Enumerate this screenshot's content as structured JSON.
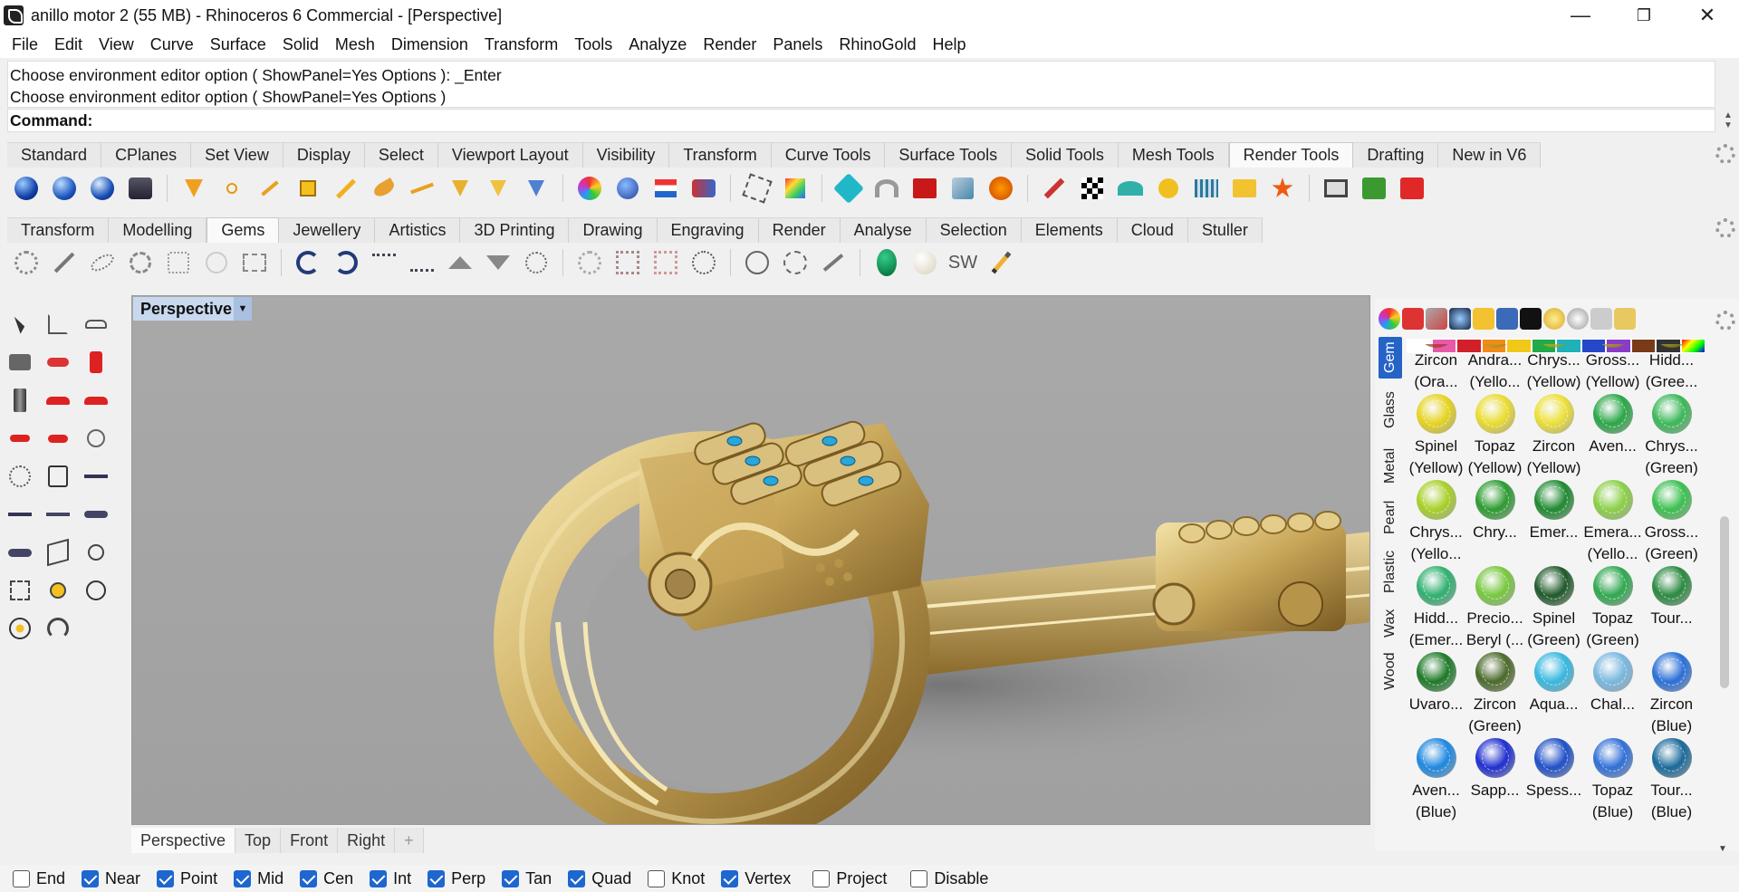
{
  "window": {
    "title": "anillo motor 2 (55 MB) - Rhinoceros 6 Commercial - [Perspective]",
    "controls": {
      "minimize": "—",
      "restore": "❐",
      "close": "✕"
    }
  },
  "menu": [
    "File",
    "Edit",
    "View",
    "Curve",
    "Surface",
    "Solid",
    "Mesh",
    "Dimension",
    "Transform",
    "Tools",
    "Analyze",
    "Render",
    "Panels",
    "RhinoGold",
    "Help"
  ],
  "command": {
    "history": [
      "Choose environment editor option ( ShowPanel=Yes  Options ): _Enter",
      "Choose environment editor option ( ShowPanel=Yes  Options )"
    ],
    "prompt": "Command:"
  },
  "toolbar_tabs_1": {
    "items": [
      "Standard",
      "CPlanes",
      "Set View",
      "Display",
      "Select",
      "Viewport Layout",
      "Visibility",
      "Transform",
      "Curve Tools",
      "Surface Tools",
      "Solid Tools",
      "Mesh Tools",
      "Render Tools",
      "Drafting",
      "New in V6"
    ],
    "active": "Render Tools"
  },
  "toolbar_tabs_2": {
    "items": [
      "Transform",
      "Modelling",
      "Gems",
      "Jewellery",
      "Artistics",
      "3D Printing",
      "Drawing",
      "Engraving",
      "Render",
      "Analyse",
      "Selection",
      "Elements",
      "Cloud",
      "Stuller"
    ],
    "active": "Gems"
  },
  "gems_toolbar": {
    "sw_label": "SW"
  },
  "viewport": {
    "name": "Perspective",
    "tabs": [
      "Perspective",
      "Top",
      "Front",
      "Right"
    ],
    "active": "Perspective",
    "add_tab": "+"
  },
  "material_panel": {
    "vtabs": [
      "Gem",
      "Glass",
      "Metal",
      "Pearl",
      "Plastic",
      "Wax",
      "Wood"
    ],
    "active_vtab": "Gem",
    "swatch_colors": [
      "#ffffff",
      "#e85aa8",
      "#d2202a",
      "#f28a1a",
      "#f0c81a",
      "#22a94a",
      "#20b0b8",
      "#2547c8",
      "#8a3cc8",
      "#7a3a18",
      "#333333"
    ],
    "gems": [
      {
        "line1": "Zircon",
        "line2": "(Ora...",
        "color": "#d04020"
      },
      {
        "line1": "Andra...",
        "line2": "(Yello...",
        "color": "#d8c020"
      },
      {
        "line1": "Chrys...",
        "line2": "(Yellow)",
        "color": "#e0d020"
      },
      {
        "line1": "Gross...",
        "line2": "(Yellow)",
        "color": "#d0c818"
      },
      {
        "line1": "Hidd...",
        "line2": "(Gree...",
        "color": "#c8c020"
      },
      {
        "line1": "Spinel",
        "line2": "(Yellow)",
        "color": "#e6d420"
      },
      {
        "line1": "Topaz",
        "line2": "(Yellow)",
        "color": "#eadc30"
      },
      {
        "line1": "Zircon",
        "line2": "(Yellow)",
        "color": "#ece03a"
      },
      {
        "line1": "Aven...",
        "line2": "",
        "color": "#2aa848"
      },
      {
        "line1": "Chrys...",
        "line2": "(Green)",
        "color": "#3cb858"
      },
      {
        "line1": "Chrys...",
        "line2": "(Yello...",
        "color": "#a8d028"
      },
      {
        "line1": "Chry...",
        "line2": "",
        "color": "#2c9c30"
      },
      {
        "line1": "Emer...",
        "line2": "",
        "color": "#1f8a30"
      },
      {
        "line1": "Emera...",
        "line2": "(Yello...",
        "color": "#8cd048"
      },
      {
        "line1": "Gross...",
        "line2": "(Green)",
        "color": "#3cc050"
      },
      {
        "line1": "Hidd...",
        "line2": "(Emer...",
        "color": "#30b070"
      },
      {
        "line1": "Precio...",
        "line2": "Beryl (...",
        "color": "#78c840"
      },
      {
        "line1": "Spinel",
        "line2": "(Green)",
        "color": "#1f5a2a"
      },
      {
        "line1": "Topaz",
        "line2": "(Green)",
        "color": "#30a850"
      },
      {
        "line1": "Tour...",
        "line2": "",
        "color": "#2a8a40"
      },
      {
        "line1": "Uvaro...",
        "line2": "",
        "color": "#1e7a28"
      },
      {
        "line1": "Zircon",
        "line2": "(Green)",
        "color": "#4a6a2a"
      },
      {
        "line1": "Aqua...",
        "line2": "",
        "color": "#38b8e0"
      },
      {
        "line1": "Chal...",
        "line2": "",
        "color": "#7ab8e0"
      },
      {
        "line1": "Zircon",
        "line2": "(Blue)",
        "color": "#2a70d8"
      },
      {
        "line1": "Aven...",
        "line2": "(Blue)",
        "color": "#1e88e0"
      },
      {
        "line1": "Sapp...",
        "line2": "",
        "color": "#2030d0"
      },
      {
        "line1": "Spess...",
        "line2": "",
        "color": "#2050c8"
      },
      {
        "line1": "Topaz",
        "line2": "(Blue)",
        "color": "#3070d8"
      },
      {
        "line1": "Tour...",
        "line2": "(Blue)",
        "color": "#1a6a9a"
      }
    ]
  },
  "osnaps": [
    {
      "label": "End",
      "checked": false
    },
    {
      "label": "Near",
      "checked": true
    },
    {
      "label": "Point",
      "checked": true
    },
    {
      "label": "Mid",
      "checked": true
    },
    {
      "label": "Cen",
      "checked": true
    },
    {
      "label": "Int",
      "checked": true
    },
    {
      "label": "Perp",
      "checked": true
    },
    {
      "label": "Tan",
      "checked": true
    },
    {
      "label": "Quad",
      "checked": true
    },
    {
      "label": "Knot",
      "checked": false
    },
    {
      "label": "Vertex",
      "checked": true
    },
    {
      "label": "Project",
      "checked": false
    },
    {
      "label": "Disable",
      "checked": false
    }
  ]
}
